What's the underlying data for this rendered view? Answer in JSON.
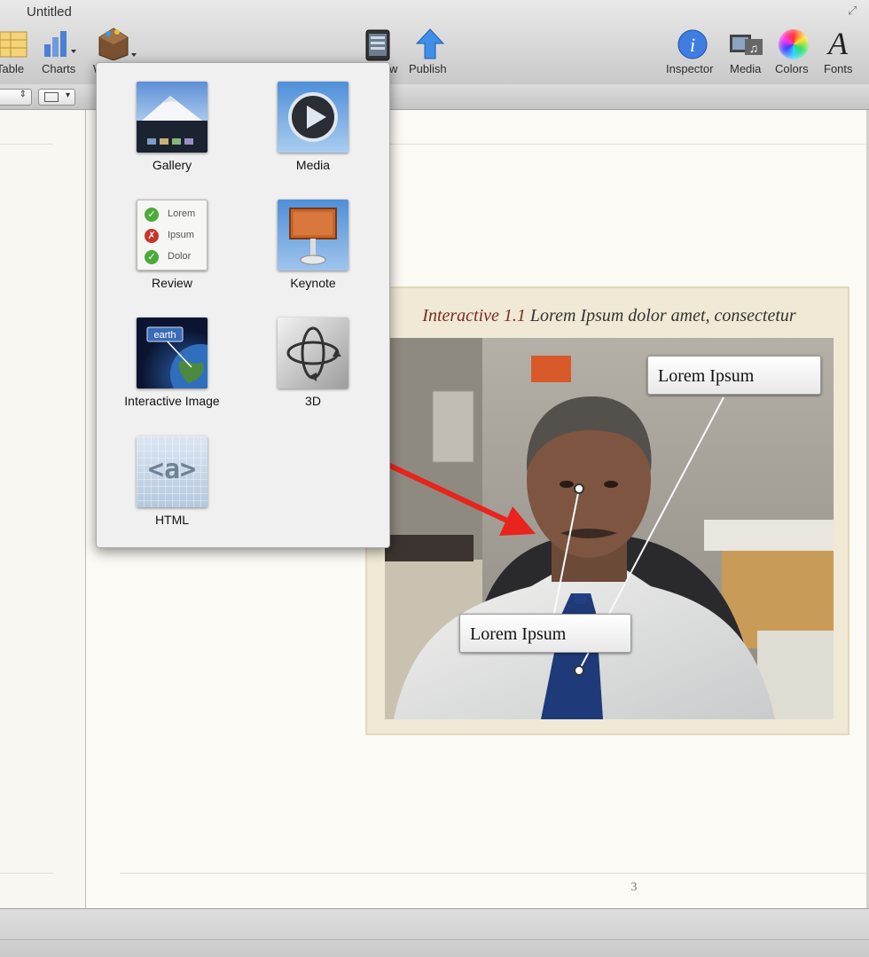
{
  "window": {
    "title": "Untitled"
  },
  "toolbar": {
    "table_label": "Table",
    "charts_label": "Charts",
    "widgets_label": "W",
    "preview_label": "w",
    "publish_label": "Publish",
    "inspector_label": "Inspector",
    "media_label": "Media",
    "colors_label": "Colors",
    "fonts_label": "Fonts"
  },
  "widget_menu": {
    "items": [
      {
        "label": "Gallery",
        "icon": "gallery-icon"
      },
      {
        "label": "Media",
        "icon": "media-play-icon"
      },
      {
        "label": "Review",
        "icon": "review-icon"
      },
      {
        "label": "Keynote",
        "icon": "keynote-icon"
      },
      {
        "label": "Interactive Image",
        "icon": "interactive-image-icon"
      },
      {
        "label": "3D",
        "icon": "3d-icon"
      },
      {
        "label": "HTML",
        "icon": "html-icon"
      }
    ],
    "review_options": [
      "Lorem",
      "Ipsum",
      "Dolor"
    ],
    "interactive_tag": "earth",
    "html_glyph": "<a>"
  },
  "document": {
    "widget": {
      "caption_label": "Interactive 1.1",
      "caption_text": " Lorem Ipsum dolor amet, consectetur",
      "callouts": [
        "Lorem Ipsum",
        "Lorem Ipsum"
      ]
    },
    "page_number": "3"
  },
  "colors": {
    "accent_arrow": "#e8241c",
    "caption_label": "#7b2b1f"
  }
}
